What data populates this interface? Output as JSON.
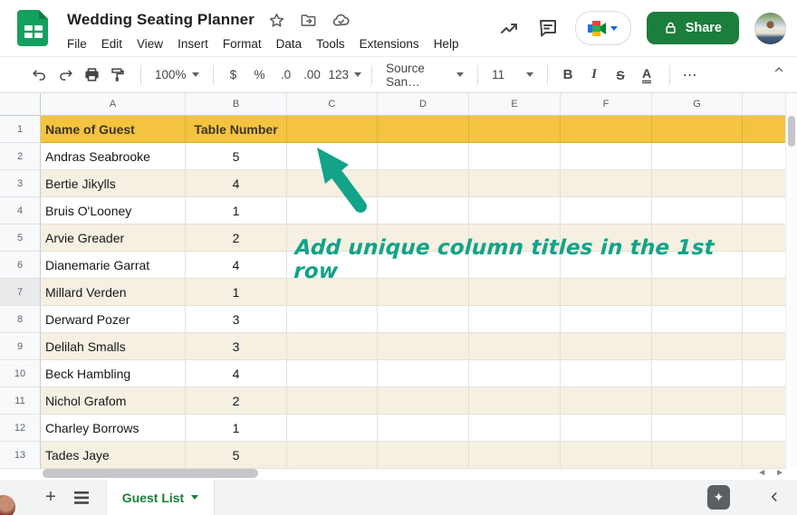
{
  "header": {
    "title": "Wedding Seating Planner",
    "menus": [
      "File",
      "Edit",
      "View",
      "Insert",
      "Format",
      "Data",
      "Tools",
      "Extensions",
      "Help"
    ],
    "share_label": "Share",
    "icons": [
      "sheets-logo",
      "star-icon",
      "move-to-folder-icon",
      "cloud-saved-icon",
      "trending-icon",
      "comment-icon",
      "meet-icon",
      "lock-icon",
      "avatar"
    ]
  },
  "toolbar": {
    "zoom_level": "100%",
    "currency": "$",
    "percent": "%",
    "decrease_decimal": ".0",
    "increase_decimal": ".00",
    "number_format": "123",
    "font_name": "Source San…",
    "font_size": "11",
    "bold": "B",
    "italic": "I",
    "strikethrough": "S",
    "text_color": "A",
    "more": "⋯",
    "icons": [
      "undo-icon",
      "redo-icon",
      "print-icon",
      "paint-format-icon",
      "chevron-up-icon"
    ]
  },
  "sheet": {
    "columns": [
      "A",
      "B",
      "C",
      "D",
      "E",
      "F",
      "G",
      ""
    ],
    "header_row": {
      "number": "1",
      "name_title": "Name of Guest",
      "table_title": "Table Number"
    },
    "rows": [
      {
        "n": "2",
        "name": "Andras Seabrooke",
        "table": "5"
      },
      {
        "n": "3",
        "name": "Bertie Jikylls",
        "table": "4"
      },
      {
        "n": "4",
        "name": "Bruis O'Looney",
        "table": "1"
      },
      {
        "n": "5",
        "name": "Arvie Greader",
        "table": "2"
      },
      {
        "n": "6",
        "name": "Dianemarie Garrat",
        "table": "4"
      },
      {
        "n": "7",
        "name": "Millard Verden",
        "table": "1"
      },
      {
        "n": "8",
        "name": "Derward Pozer",
        "table": "3"
      },
      {
        "n": "9",
        "name": "Delilah Smalls",
        "table": "3"
      },
      {
        "n": "10",
        "name": "Beck Hambling",
        "table": "4"
      },
      {
        "n": "11",
        "name": "Nichol Grafom",
        "table": "2"
      },
      {
        "n": "12",
        "name": "Charley Borrows",
        "table": "1"
      },
      {
        "n": "13",
        "name": "Tades Jaye",
        "table": "5"
      }
    ]
  },
  "annotation": {
    "text": "Add unique column titles in the 1st row",
    "arrow": "teal-arrow-pointing-to-row-1"
  },
  "footer": {
    "active_sheet": "Guest List",
    "icons": [
      "add-sheet-icon",
      "all-sheets-icon",
      "explore-star-icon",
      "chevron-left-icon"
    ]
  },
  "colors": {
    "share_green": "#1b7e3c",
    "sheets_logo_green": "#12a15f",
    "tab_green": "#188038",
    "annotation_teal": "#12a389",
    "band_yellow": "#f4c440",
    "band_cream": "#f5f0e2"
  }
}
